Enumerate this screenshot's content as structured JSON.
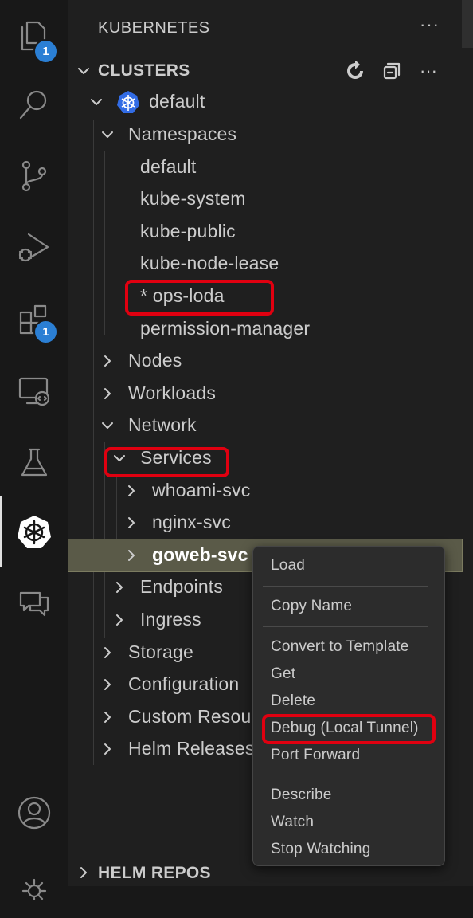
{
  "activity_bar": {
    "explorer_badge": "1",
    "extensions_badge": "1"
  },
  "panel": {
    "title": "KUBERNETES",
    "more_label": "···",
    "clusters_section": {
      "title": "CLUSTERS",
      "more_label": "···"
    },
    "tree": {
      "cluster": "default",
      "namespaces": "Namespaces",
      "namespace_items": [
        "default",
        "kube-system",
        "kube-public",
        "kube-node-lease",
        "* ops-loda",
        "permission-manager"
      ],
      "nodes": "Nodes",
      "workloads": "Workloads",
      "network": "Network",
      "services": "Services",
      "service_items": [
        "whoami-svc",
        "nginx-svc",
        "goweb-svc"
      ],
      "endpoints": "Endpoints",
      "ingress": "Ingress",
      "storage": "Storage",
      "configuration": "Configuration",
      "custom_resources": "Custom Resou",
      "helm_releases": "Helm Releases"
    },
    "helm_repos_section": {
      "title": "HELM REPOS"
    }
  },
  "context_menu": {
    "items": [
      "Load",
      "Copy Name",
      "Convert to Template",
      "Get",
      "Delete",
      "Debug (Local Tunnel)",
      "Port Forward",
      "Describe",
      "Watch",
      "Stop Watching"
    ]
  },
  "colors": {
    "highlight": "#e00010",
    "badge": "#2b7fd4",
    "selected_row": "#5a5a48",
    "k8s_blue": "#326ce5"
  }
}
